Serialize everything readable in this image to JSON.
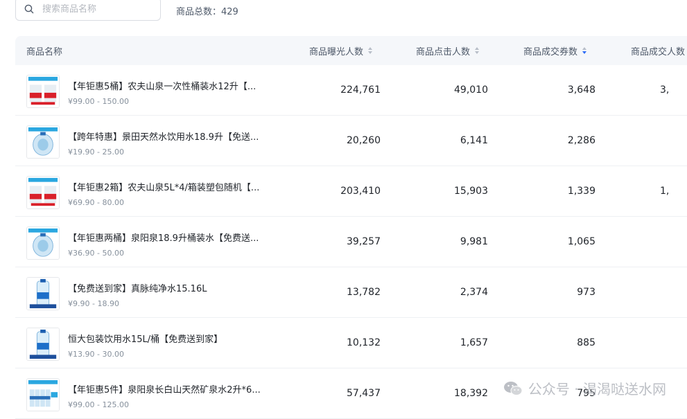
{
  "search": {
    "placeholder": "搜索商品名称"
  },
  "summary": {
    "total_text": "商品总数：429"
  },
  "columns": {
    "name": "商品名称",
    "exposure": "商品曝光人数",
    "clicks": "商品点击人数",
    "coupon_deals": "商品成交券数",
    "deal_users": "商品成交人数"
  },
  "rows": [
    {
      "name": "【年钜惠5桶】农夫山泉一次性桶装水12升【...",
      "price": "¥99.00 - 150.00",
      "exposure": "224,761",
      "clicks": "49,010",
      "coupons": "3,648",
      "users": "3,",
      "thumb": "red"
    },
    {
      "name": "【跨年特惠】景田天然水饮用水18.9升【免送...",
      "price": "¥19.90 - 25.00",
      "exposure": "20,260",
      "clicks": "6,141",
      "coupons": "2,286",
      "users": "",
      "thumb": "blue-bucket"
    },
    {
      "name": "【年钜惠2箱】农夫山泉5L*4/箱装塑包随机【...",
      "price": "¥69.90 - 80.00",
      "exposure": "203,410",
      "clicks": "15,903",
      "coupons": "1,339",
      "users": "1,",
      "thumb": "red"
    },
    {
      "name": "【年钜惠两桶】泉阳泉18.9升桶装水【免费送...",
      "price": "¥36.90 - 50.00",
      "exposure": "39,257",
      "clicks": "9,981",
      "coupons": "1,065",
      "users": "",
      "thumb": "blue-bucket"
    },
    {
      "name": "【免费送到家】真脉纯净水15.16L",
      "price": "¥9.90 - 18.90",
      "exposure": "13,782",
      "clicks": "2,374",
      "coupons": "973",
      "users": "",
      "thumb": "blue-bottle"
    },
    {
      "name": "恒大包装饮用水15L/桶【免费送到家】",
      "price": "¥13.90 - 30.00",
      "exposure": "10,132",
      "clicks": "1,657",
      "coupons": "885",
      "users": "",
      "thumb": "blue-bottle"
    },
    {
      "name": "【年钜惠5件】泉阳泉长白山天然矿泉水2升*6...",
      "price": "¥99.00 - 125.00",
      "exposure": "57,437",
      "clicks": "18,392",
      "coupons": "795",
      "users": "",
      "thumb": "bottles"
    }
  ],
  "watermark": {
    "text": "公众号 · 渴渴哒送水网"
  },
  "colors": {
    "accent": "#2d6cf6",
    "header_bg": "#f5f7fa"
  }
}
